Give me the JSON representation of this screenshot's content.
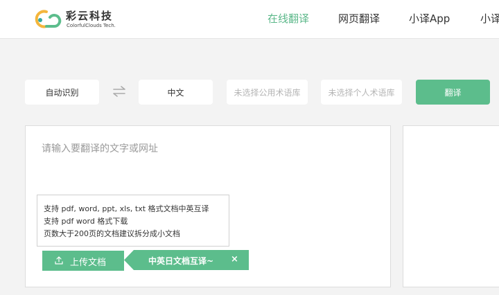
{
  "brand": {
    "name_cn": "彩云科技",
    "name_en": "ColorfulClouds Tech.",
    "colors": {
      "green": "#5cbd8c",
      "yellow": "#f4b63c",
      "teal": "#33a9a2"
    }
  },
  "nav": {
    "items": [
      {
        "label": "在线翻译",
        "active": true
      },
      {
        "label": "网页翻译",
        "active": false
      },
      {
        "label": "小译App",
        "active": false
      },
      {
        "label": "小译",
        "active": false
      }
    ]
  },
  "toolbar": {
    "source_language": "自动识别",
    "swap_icon": "swap-arrows-icon",
    "target_language": "中文",
    "public_library": "未选择公用术语库",
    "private_library": "未选择个人术语库",
    "translate_label": "翻译"
  },
  "source_panel": {
    "placeholder": "请输入要翻译的文字或网址",
    "tips": [
      "支持 pdf, word, ppt, xls, txt 格式文档中英互译",
      "支持 pdf word 格式下载",
      "页数大于200页的文档建议拆分成小文档"
    ],
    "upload_label": "上传文档",
    "upload_icon": "upload-icon",
    "promo_label": "中英日文档互译~",
    "promo_close": "×"
  }
}
